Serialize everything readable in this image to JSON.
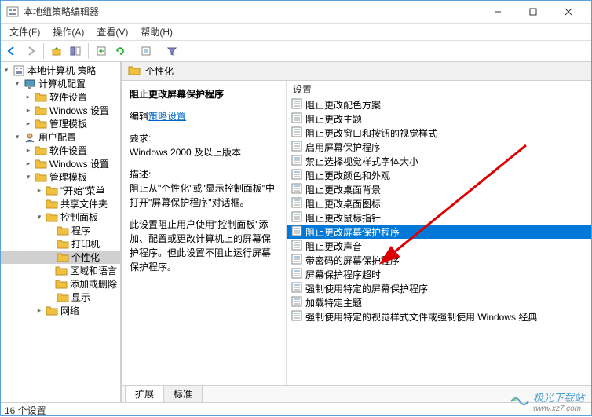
{
  "window": {
    "title": "本地组策略编辑器"
  },
  "menus": [
    "文件(F)",
    "操作(A)",
    "查看(V)",
    "帮助(H)"
  ],
  "tree": {
    "root": "本地计算机 策略",
    "computer": {
      "label": "计算机配置",
      "children": [
        "软件设置",
        "Windows 设置",
        "管理模板"
      ]
    },
    "user": {
      "label": "用户配置",
      "software": "软件设置",
      "windows": "Windows 设置",
      "admin": {
        "label": "管理模板",
        "start": "\"开始\"菜单",
        "shared": "共享文件夹",
        "cpl": {
          "label": "控制面板",
          "programs": "程序",
          "printers": "打印机",
          "personalization": "个性化",
          "region": "区域和语言",
          "addremove": "添加或删除",
          "display": "显示"
        },
        "network": "网络"
      }
    }
  },
  "header": {
    "title": "个性化"
  },
  "detail": {
    "name": "阻止更改屏幕保护程序",
    "edit_prefix": "编辑",
    "edit_link": "策略设置",
    "req_label": "要求:",
    "req_value": "Windows 2000 及以上版本",
    "desc_label": "描述:",
    "desc1": "阻止从\"个性化\"或\"显示控制面板\"中打开\"屏幕保护程序\"对话框。",
    "desc2": "此设置阻止用户使用\"控制面板\"添加、配置或更改计算机上的屏幕保护程序。但此设置不阻止运行屏幕保护程序。"
  },
  "list_header": "设置",
  "settings": [
    "阻止更改配色方案",
    "阻止更改主题",
    "阻止更改窗口和按钮的视觉样式",
    "启用屏幕保护程序",
    "禁止选择视觉样式字体大小",
    "阻止更改颜色和外观",
    "阻止更改桌面背景",
    "阻止更改桌面图标",
    "阻止更改鼠标指针",
    "阻止更改屏幕保护程序",
    "阻止更改声音",
    "带密码的屏幕保护程序",
    "屏幕保护程序超时",
    "强制使用特定的屏幕保护程序",
    "加载特定主题",
    "强制使用特定的视觉样式文件或强制使用 Windows 经典"
  ],
  "selected_index": 9,
  "tabs": {
    "extended": "扩展",
    "standard": "标准"
  },
  "status": "16 个设置",
  "watermark": {
    "text": "极光下载站",
    "url": "www.xz7.com"
  }
}
